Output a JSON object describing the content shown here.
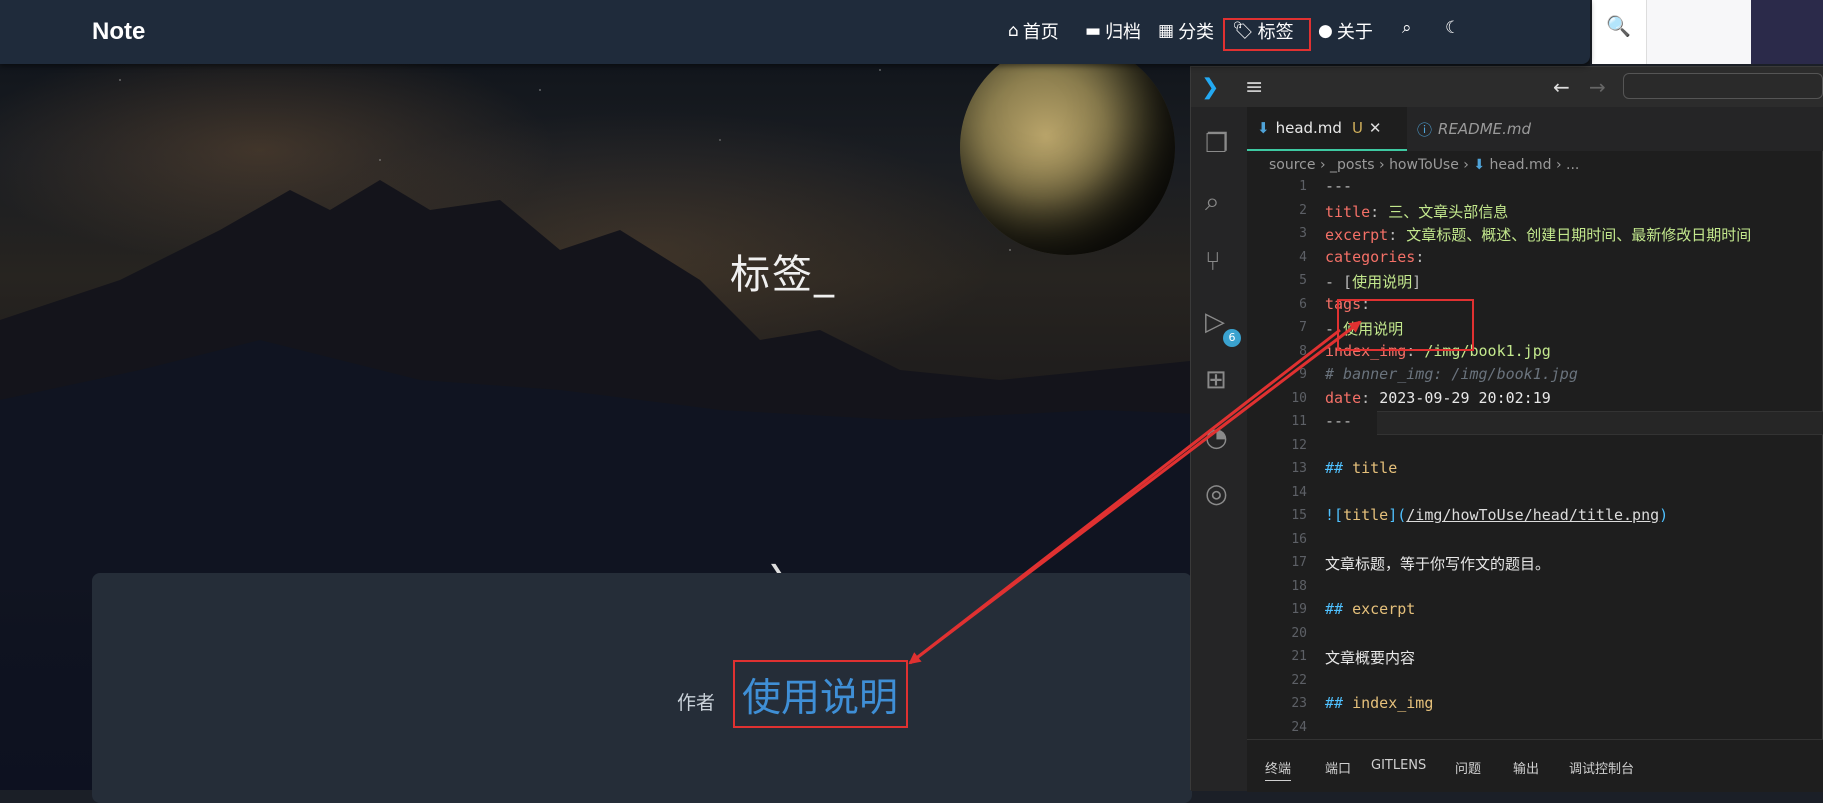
{
  "blog": {
    "brand": "Note",
    "nav": {
      "home": "首页",
      "archive": "归档",
      "categories": "分类",
      "tags": "标签",
      "about": "关于"
    },
    "hero_title": "标签_",
    "card": {
      "author_label": "作者",
      "tag_link": "使用说明"
    }
  },
  "vscode": {
    "tabs": [
      {
        "label": "head.md",
        "status": "U",
        "active": true
      },
      {
        "label": "README.md",
        "active": false
      }
    ],
    "breadcrumb": [
      "source",
      "_posts",
      "howToUse",
      "head.md",
      "..."
    ],
    "git_badge": "6",
    "lines": [
      {
        "n": "1",
        "parts": [
          {
            "c": "sym",
            "t": "---"
          }
        ]
      },
      {
        "n": "2",
        "parts": [
          {
            "c": "k",
            "t": "title"
          },
          {
            "c": "sym",
            "t": ": "
          },
          {
            "c": "str",
            "t": "三、文章头部信息"
          }
        ]
      },
      {
        "n": "3",
        "parts": [
          {
            "c": "k",
            "t": "excerpt"
          },
          {
            "c": "sym",
            "t": ": "
          },
          {
            "c": "str",
            "t": "文章标题、概述、创建日期时间、最新修改日期时间"
          }
        ]
      },
      {
        "n": "4",
        "parts": [
          {
            "c": "k",
            "t": "categories"
          },
          {
            "c": "sym",
            "t": ":"
          }
        ]
      },
      {
        "n": "5",
        "parts": [
          {
            "c": "sym",
            "t": "  - ["
          },
          {
            "c": "str",
            "t": "使用说明"
          },
          {
            "c": "sym",
            "t": "]"
          }
        ]
      },
      {
        "n": "6",
        "parts": [
          {
            "c": "k",
            "t": "tags"
          },
          {
            "c": "sym",
            "t": ":"
          }
        ]
      },
      {
        "n": "7",
        "parts": [
          {
            "c": "sym",
            "t": "  - "
          },
          {
            "c": "str",
            "t": "使用说明"
          }
        ]
      },
      {
        "n": "8",
        "parts": [
          {
            "c": "k",
            "t": "index_img"
          },
          {
            "c": "sym",
            "t": ": "
          },
          {
            "c": "str",
            "t": "/img/book1.jpg"
          }
        ]
      },
      {
        "n": "9",
        "parts": [
          {
            "c": "com",
            "t": "# banner_img: /img/book1.jpg"
          }
        ]
      },
      {
        "n": "10",
        "parts": [
          {
            "c": "k",
            "t": "date"
          },
          {
            "c": "sym",
            "t": ": "
          },
          {
            "c": "v",
            "t": "2023-09-29 20:02:19"
          }
        ]
      },
      {
        "n": "11",
        "parts": [
          {
            "c": "sym",
            "t": "---"
          }
        ]
      },
      {
        "n": "12",
        "parts": []
      },
      {
        "n": "13",
        "parts": [
          {
            "c": "h",
            "t": "## "
          },
          {
            "c": "hv",
            "t": "title"
          }
        ]
      },
      {
        "n": "14",
        "parts": []
      },
      {
        "n": "15",
        "parts": [
          {
            "c": "h",
            "t": "!["
          },
          {
            "c": "hv",
            "t": "title"
          },
          {
            "c": "h",
            "t": "]("
          },
          {
            "c": "lnk",
            "t": "/img/howToUse/head/title.png"
          },
          {
            "c": "h",
            "t": ")"
          }
        ]
      },
      {
        "n": "16",
        "parts": []
      },
      {
        "n": "17",
        "parts": [
          {
            "c": "v",
            "t": "文章标题，等于你写作文的题目。"
          }
        ]
      },
      {
        "n": "18",
        "parts": []
      },
      {
        "n": "19",
        "parts": [
          {
            "c": "h",
            "t": "## "
          },
          {
            "c": "hv",
            "t": "excerpt"
          }
        ]
      },
      {
        "n": "20",
        "parts": []
      },
      {
        "n": "21",
        "parts": [
          {
            "c": "v",
            "t": "文章概要内容"
          }
        ]
      },
      {
        "n": "22",
        "parts": []
      },
      {
        "n": "23",
        "parts": [
          {
            "c": "h",
            "t": "## "
          },
          {
            "c": "hv",
            "t": "index_img"
          }
        ]
      },
      {
        "n": "24",
        "parts": []
      }
    ],
    "panel_tabs": [
      "终端",
      "端口",
      "GITLENS",
      "问题",
      "输出",
      "调试控制台"
    ]
  },
  "icons": {
    "home": "home-icon",
    "archive": "archive-icon",
    "categories": "grid-icon",
    "tags": "tag-icon",
    "about": "user-icon",
    "search": "search-icon",
    "theme": "moon-icon"
  },
  "colors": {
    "navbar": "#1f2b3b",
    "highlight": "#e03131",
    "tag_link": "#3f8fd6",
    "yaml_key": "#f47067",
    "yaml_value": "#c3e88d"
  }
}
